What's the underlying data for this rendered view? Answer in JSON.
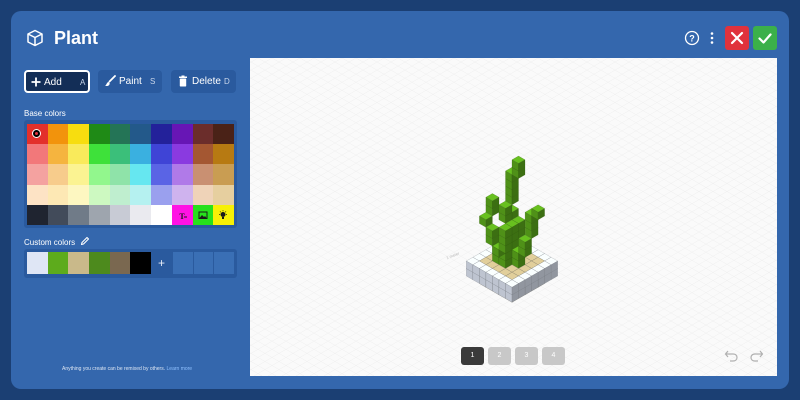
{
  "header": {
    "title": "Plant",
    "title_icon": "cube-icon",
    "help_icon": "help-icon",
    "more_icon": "more-icon",
    "cancel_icon": "close-icon",
    "confirm_icon": "checkmark-icon"
  },
  "tools": [
    {
      "label": "Add",
      "shortcut": "A",
      "icon": "plus-icon",
      "active": true
    },
    {
      "label": "Paint",
      "shortcut": "S",
      "icon": "brush-icon",
      "active": false
    },
    {
      "label": "Delete",
      "shortcut": "D",
      "icon": "trash-icon",
      "active": false
    }
  ],
  "base_colors": {
    "label": "Base colors",
    "swatches": [
      "#e3302b",
      "#f2930c",
      "#f7dd0f",
      "#1f8a16",
      "#247456",
      "#23598a",
      "#23219a",
      "#6716b5",
      "#6b2d2b",
      "#4a2217",
      "#f2787a",
      "#f5b43f",
      "#f9ea5b",
      "#3ee13a",
      "#3bbf7a",
      "#3ab0e0",
      "#3f44d6",
      "#8a3ae0",
      "#a45732",
      "#b77a12",
      "#f4a2a0",
      "#f7cc8c",
      "#fbf392",
      "#92f78d",
      "#8fe3a9",
      "#66e7f0",
      "#5a64e5",
      "#b07ae8",
      "#c99072",
      "#c99d52",
      "#fde3c5",
      "#fde8b4",
      "#fdf7c1",
      "#cdf9c1",
      "#bfeecf",
      "#b5f1f0",
      "#9aa0ee",
      "#cfb3ee",
      "#efd3b8",
      "#e6cf9f",
      "#1f2430",
      "#424b5a",
      "#707b88",
      "#9ea5ae",
      "#c8cbd5",
      "#eaeaef",
      "#ffffff",
      "#ff12e4",
      "#27e01c",
      "#f7f006"
    ],
    "selected_index": 0,
    "special_icons": {
      "47": "text-color-icon",
      "48": "image-icon",
      "49": "light-icon"
    }
  },
  "custom_colors": {
    "label": "Custom colors",
    "edit_icon": "pencil-icon",
    "swatches": [
      "#dfe6f5",
      "#5dab1c",
      "#c9b98a",
      "#4d8a1d",
      "#7a6850",
      "#000000"
    ],
    "add_label": "+",
    "empty_slots": 3
  },
  "footer": {
    "note": "Anything you create can be remixed by others.",
    "link": "Learn more"
  },
  "canvas": {
    "scale_label": "1 meter",
    "pages": [
      "1",
      "2",
      "3",
      "4"
    ],
    "active_page": 0,
    "undo_icon": "undo-icon",
    "redo_icon": "redo-icon",
    "model_colors": {
      "plant": "#5dab1c",
      "pot": "#dfe6f5",
      "soil": "#c9b98a"
    }
  }
}
